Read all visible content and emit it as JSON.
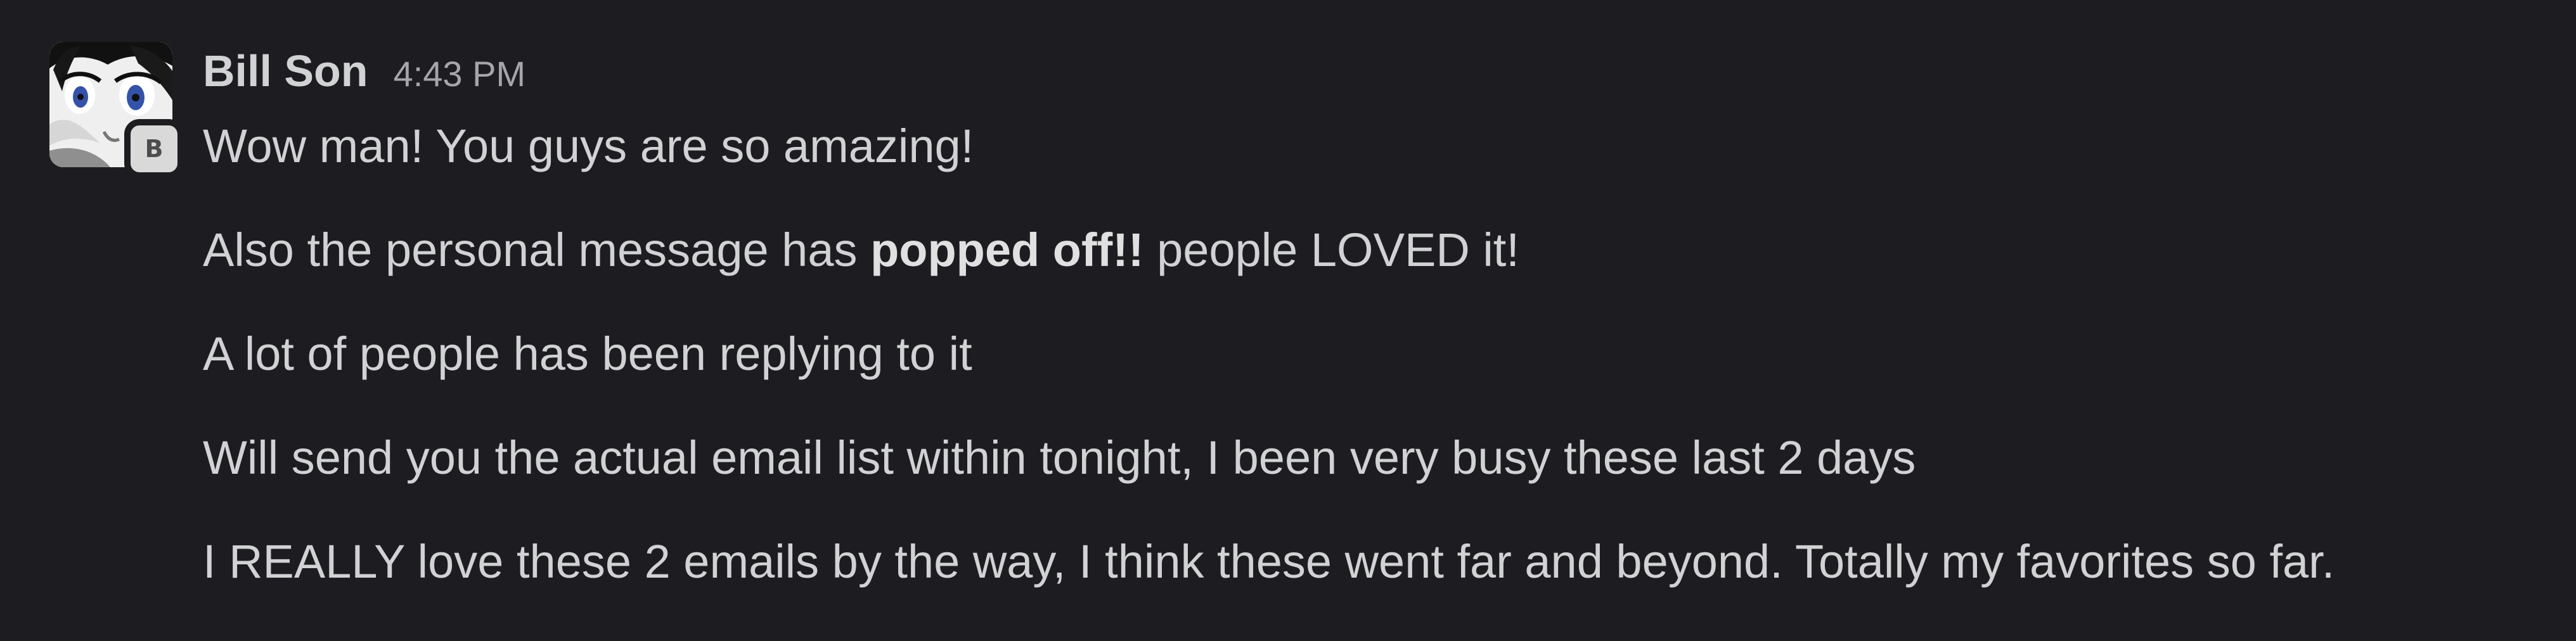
{
  "message": {
    "sender": "Bill Son",
    "timestamp": "4:43 PM",
    "initial_badge": "B",
    "avatar_icon": "anime-character-avatar-icon",
    "lines": [
      {
        "text": "Wow man! You guys are so amazing!"
      },
      {
        "before": "Also the personal message has ",
        "bold": "popped off!!",
        "after": " people LOVED it!"
      },
      {
        "text": "A lot of people has been replying to it"
      },
      {
        "text": "Will send you the actual email list within tonight, I been very busy these last 2 days"
      },
      {
        "text": "I REALLY love these 2 emails by the way, I think these went far and beyond. Totally my favorites so far."
      }
    ]
  },
  "colors": {
    "background": "#1d1d21",
    "text": "#d1d2d3",
    "timestamp": "#a6a6a8",
    "badge": "#d9d9d9"
  }
}
